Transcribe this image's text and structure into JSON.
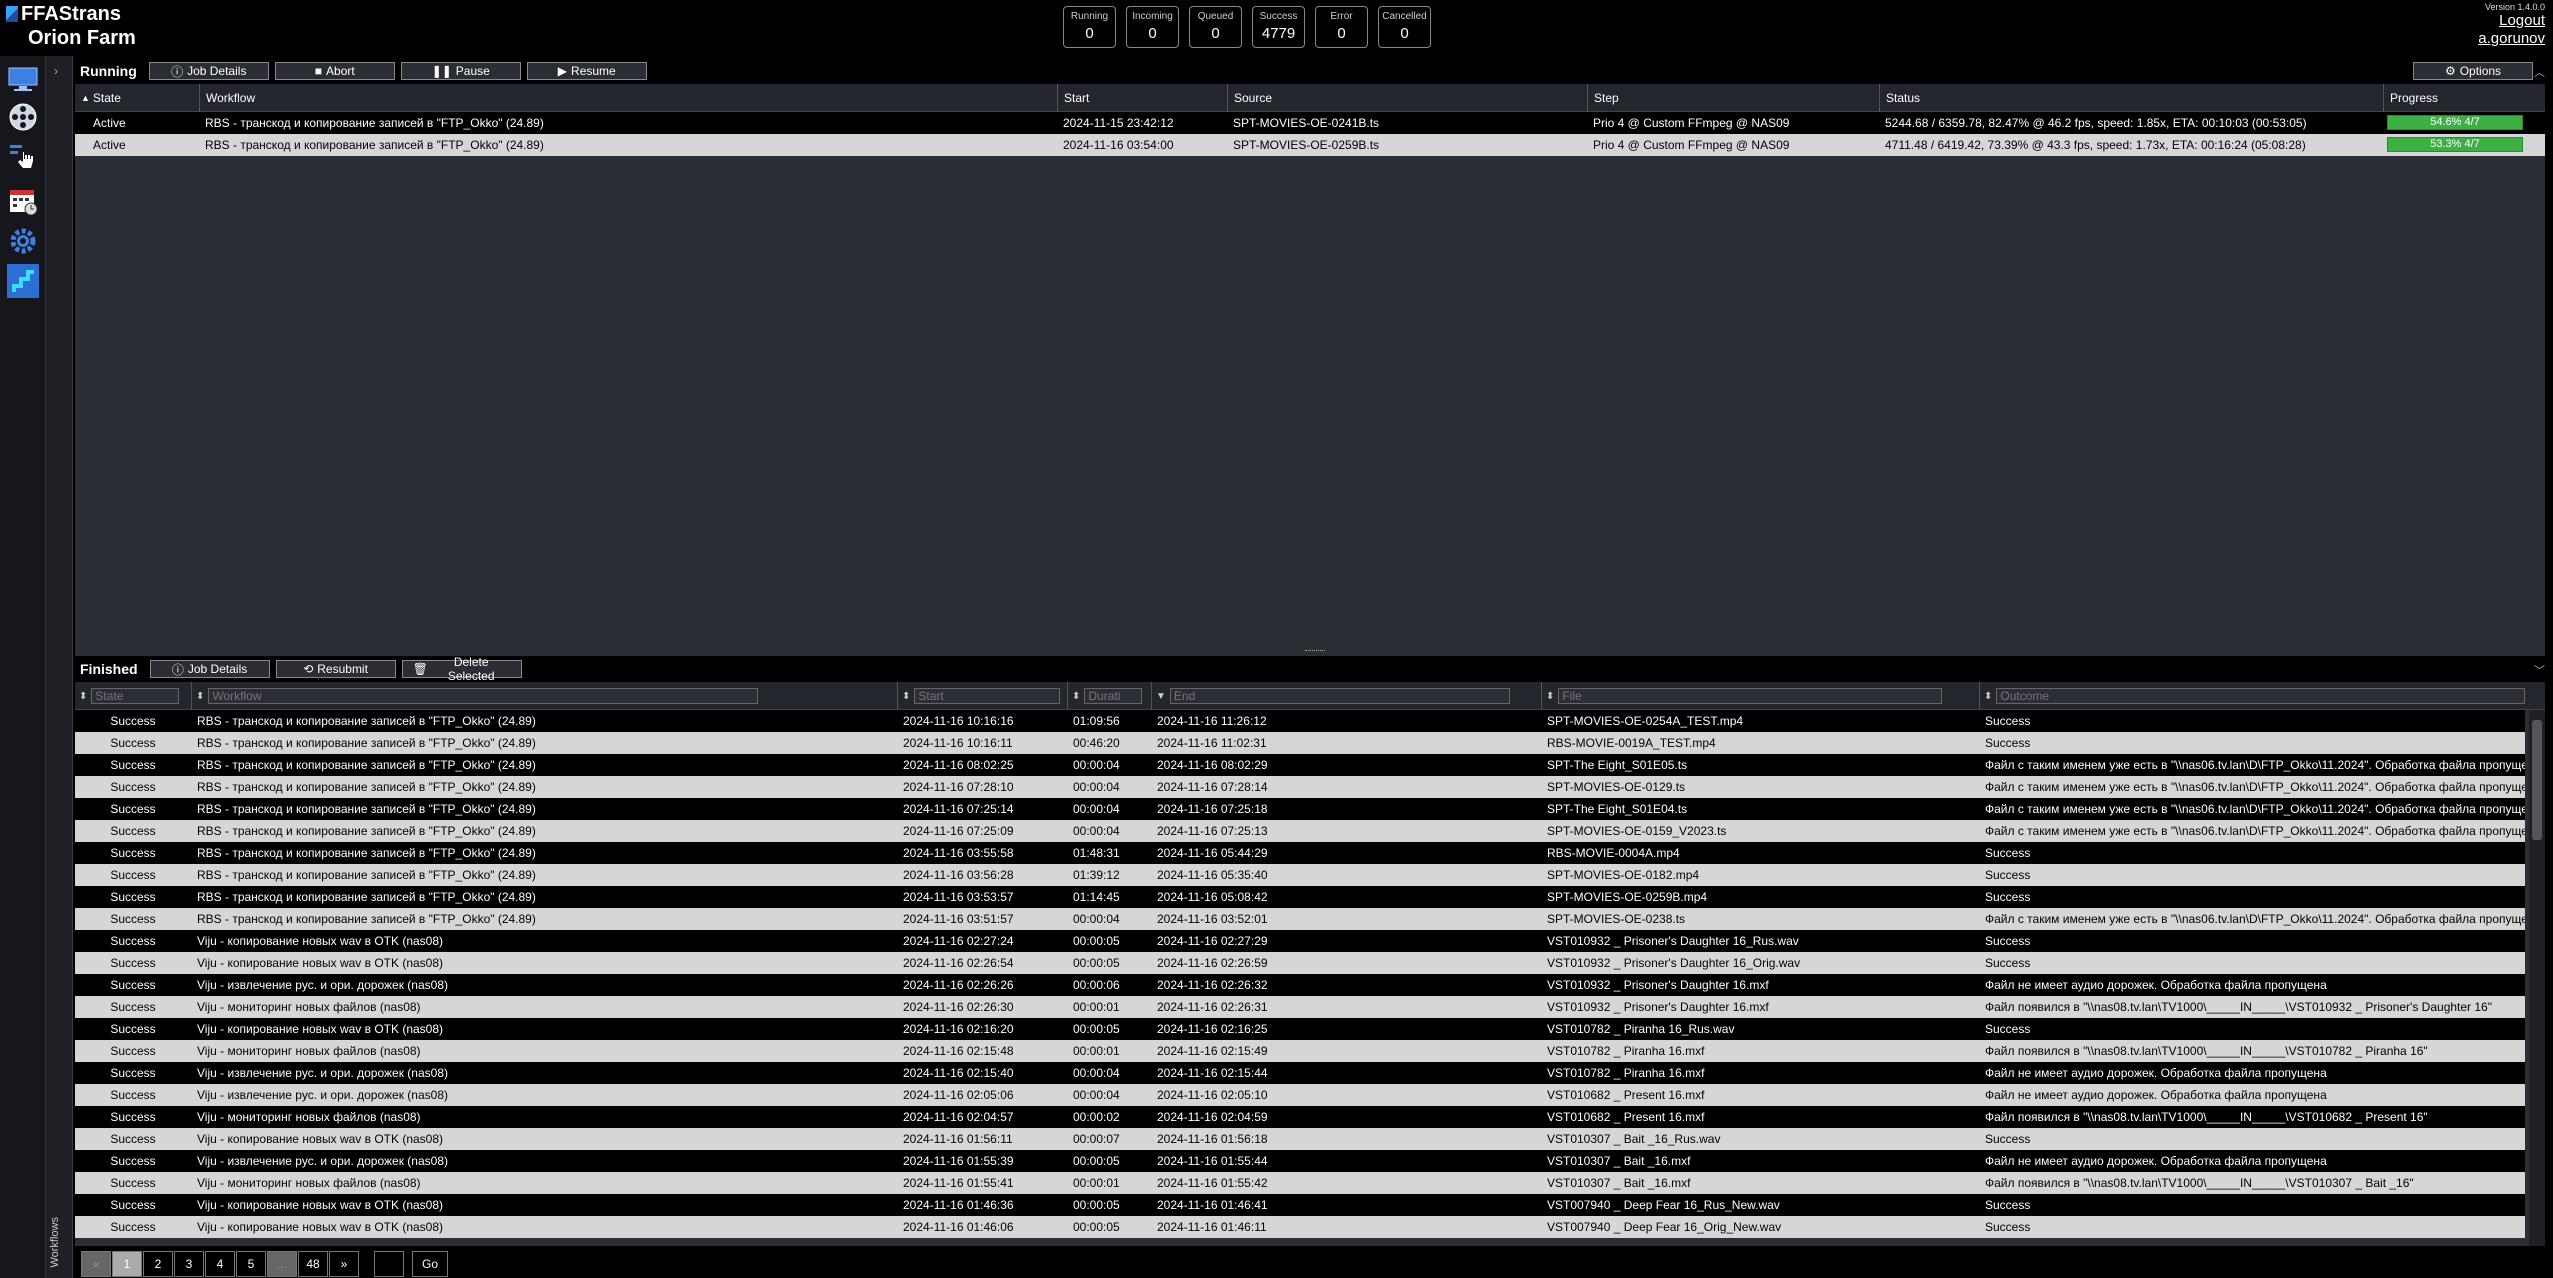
{
  "brand": {
    "line1": "FFAStrans",
    "line2": "Orion Farm"
  },
  "counters": [
    {
      "label": "Running",
      "value": "0"
    },
    {
      "label": "Incoming",
      "value": "0"
    },
    {
      "label": "Queued",
      "value": "0"
    },
    {
      "label": "Success",
      "value": "4779"
    },
    {
      "label": "Error",
      "value": "0"
    },
    {
      "label": "Cancelled",
      "value": "0"
    }
  ],
  "user": {
    "version": "Version 1.4.0.0",
    "logout": "Logout",
    "username": "a.gorunov"
  },
  "sidebar": {
    "workflows_label": "Workflows"
  },
  "running": {
    "title": "Running",
    "buttons": {
      "job_details": "Job Details",
      "abort": "Abort",
      "pause": "Pause",
      "resume": "Resume",
      "options": "Options"
    },
    "columns": [
      "State",
      "Workflow",
      "Start",
      "Source",
      "Step",
      "Status",
      "Progress"
    ],
    "rows": [
      {
        "state": "Active",
        "workflow": "RBS - транскод и копирование записей в \"FTP_Okko\" (24.89)",
        "start": "2024-11-15 23:42:12",
        "source": "SPT-MOVIES-OE-0241B.ts",
        "step": "Prio 4 @ Custom FFmpeg @ NAS09",
        "status": "5244.68 / 6359.78, 82.47% @ 46.2 fps, speed: 1.85x, ETA: 00:10:03 (00:53:05)",
        "progress": "54.6% 4/7",
        "progress_value": 0.546
      },
      {
        "state": "Active",
        "workflow": "RBS - транскод и копирование записей в \"FTP_Okko\" (24.89)",
        "start": "2024-11-16 03:54:00",
        "source": "SPT-MOVIES-OE-0259B.ts",
        "step": "Prio 4 @ Custom FFmpeg @ NAS09",
        "status": "4711.48 / 6419.42, 73.39% @ 43.3 fps, speed: 1.73x, ETA: 00:16:24 (05:08:28)",
        "progress": "53.3% 4/7",
        "progress_value": 0.533
      }
    ]
  },
  "finished": {
    "title": "Finished",
    "buttons": {
      "job_details": "Job Details",
      "resubmit": "Resubmit",
      "delete_selected": "Delete Selected"
    },
    "filters": {
      "state": "State",
      "workflow": "Workflow",
      "start": "Start",
      "duration": "Durati",
      "end": "End",
      "file": "File",
      "outcome": "Outcome"
    },
    "rows": [
      {
        "state": "Success",
        "workflow": "RBS - транскод и копирование записей в \"FTP_Okko\" (24.89)",
        "start": "2024-11-16 10:16:16",
        "duration": "01:09:56",
        "end": "2024-11-16 11:26:12",
        "file": "SPT-MOVIES-OE-0254A_TEST.mp4",
        "outcome": "Success"
      },
      {
        "state": "Success",
        "workflow": "RBS - транскод и копирование записей в \"FTP_Okko\" (24.89)",
        "start": "2024-11-16 10:16:11",
        "duration": "00:46:20",
        "end": "2024-11-16 11:02:31",
        "file": "RBS-MOVIE-0019A_TEST.mp4",
        "outcome": "Success"
      },
      {
        "state": "Success",
        "workflow": "RBS - транскод и копирование записей в \"FTP_Okko\" (24.89)",
        "start": "2024-11-16 08:02:25",
        "duration": "00:00:04",
        "end": "2024-11-16 08:02:29",
        "file": "SPT-The Eight_S01E05.ts",
        "outcome": "Файл с таким именем уже есть в \"\\\\nas06.tv.lan\\D\\FTP_Okko\\11.2024\". Обработка файла пропущена"
      },
      {
        "state": "Success",
        "workflow": "RBS - транскод и копирование записей в \"FTP_Okko\" (24.89)",
        "start": "2024-11-16 07:28:10",
        "duration": "00:00:04",
        "end": "2024-11-16 07:28:14",
        "file": "SPT-MOVIES-OE-0129.ts",
        "outcome": "Файл с таким именем уже есть в \"\\\\nas06.tv.lan\\D\\FTP_Okko\\11.2024\". Обработка файла пропущена"
      },
      {
        "state": "Success",
        "workflow": "RBS - транскод и копирование записей в \"FTP_Okko\" (24.89)",
        "start": "2024-11-16 07:25:14",
        "duration": "00:00:04",
        "end": "2024-11-16 07:25:18",
        "file": "SPT-The Eight_S01E04.ts",
        "outcome": "Файл с таким именем уже есть в \"\\\\nas06.tv.lan\\D\\FTP_Okko\\11.2024\". Обработка файла пропущена"
      },
      {
        "state": "Success",
        "workflow": "RBS - транскод и копирование записей в \"FTP_Okko\" (24.89)",
        "start": "2024-11-16 07:25:09",
        "duration": "00:00:04",
        "end": "2024-11-16 07:25:13",
        "file": "SPT-MOVIES-OE-0159_V2023.ts",
        "outcome": "Файл с таким именем уже есть в \"\\\\nas06.tv.lan\\D\\FTP_Okko\\11.2024\". Обработка файла пропущена"
      },
      {
        "state": "Success",
        "workflow": "RBS - транскод и копирование записей в \"FTP_Okko\" (24.89)",
        "start": "2024-11-16 03:55:58",
        "duration": "01:48:31",
        "end": "2024-11-16 05:44:29",
        "file": "RBS-MOVIE-0004A.mp4",
        "outcome": "Success"
      },
      {
        "state": "Success",
        "workflow": "RBS - транскод и копирование записей в \"FTP_Okko\" (24.89)",
        "start": "2024-11-16 03:56:28",
        "duration": "01:39:12",
        "end": "2024-11-16 05:35:40",
        "file": "SPT-MOVIES-OE-0182.mp4",
        "outcome": "Success"
      },
      {
        "state": "Success",
        "workflow": "RBS - транскод и копирование записей в \"FTP_Okko\" (24.89)",
        "start": "2024-11-16 03:53:57",
        "duration": "01:14:45",
        "end": "2024-11-16 05:08:42",
        "file": "SPT-MOVIES-OE-0259B.mp4",
        "outcome": "Success"
      },
      {
        "state": "Success",
        "workflow": "RBS - транскод и копирование записей в \"FTP_Okko\" (24.89)",
        "start": "2024-11-16 03:51:57",
        "duration": "00:00:04",
        "end": "2024-11-16 03:52:01",
        "file": "SPT-MOVIES-OE-0238.ts",
        "outcome": "Файл с таким именем уже есть в \"\\\\nas06.tv.lan\\D\\FTP_Okko\\11.2024\". Обработка файла пропущена"
      },
      {
        "state": "Success",
        "workflow": "Viju - копирование новых wav в OTK (nas08)",
        "start": "2024-11-16 02:27:24",
        "duration": "00:00:05",
        "end": "2024-11-16 02:27:29",
        "file": "VST010932 _ Prisoner's Daughter 16_Rus.wav",
        "outcome": "Success"
      },
      {
        "state": "Success",
        "workflow": "Viju - копирование новых wav в OTK (nas08)",
        "start": "2024-11-16 02:26:54",
        "duration": "00:00:05",
        "end": "2024-11-16 02:26:59",
        "file": "VST010932 _ Prisoner's Daughter 16_Orig.wav",
        "outcome": "Success"
      },
      {
        "state": "Success",
        "workflow": "Viju - извлечение рус. и ори. дорожек (nas08)",
        "start": "2024-11-16 02:26:26",
        "duration": "00:00:06",
        "end": "2024-11-16 02:26:32",
        "file": "VST010932 _ Prisoner's Daughter 16.mxf",
        "outcome": "Файл не имеет аудио дорожек. Обработка файла пропущена"
      },
      {
        "state": "Success",
        "workflow": "Viju - мониторинг новых файлов (nas08)",
        "start": "2024-11-16 02:26:30",
        "duration": "00:00:01",
        "end": "2024-11-16 02:26:31",
        "file": "VST010932 _ Prisoner's Daughter 16.mxf",
        "outcome": "Файл появился в \"\\\\nas08.tv.lan\\TV1000\\_____IN_____\\VST010932 _ Prisoner's Daughter 16\""
      },
      {
        "state": "Success",
        "workflow": "Viju - копирование новых wav в OTK (nas08)",
        "start": "2024-11-16 02:16:20",
        "duration": "00:00:05",
        "end": "2024-11-16 02:16:25",
        "file": "VST010782 _ Piranha 16_Rus.wav",
        "outcome": "Success"
      },
      {
        "state": "Success",
        "workflow": "Viju - мониторинг новых файлов (nas08)",
        "start": "2024-11-16 02:15:48",
        "duration": "00:00:01",
        "end": "2024-11-16 02:15:49",
        "file": "VST010782 _ Piranha 16.mxf",
        "outcome": "Файл появился в \"\\\\nas08.tv.lan\\TV1000\\_____IN_____\\VST010782 _ Piranha 16\""
      },
      {
        "state": "Success",
        "workflow": "Viju - извлечение рус. и ори. дорожек (nas08)",
        "start": "2024-11-16 02:15:40",
        "duration": "00:00:04",
        "end": "2024-11-16 02:15:44",
        "file": "VST010782 _ Piranha 16.mxf",
        "outcome": "Файл не имеет аудио дорожек. Обработка файла пропущена"
      },
      {
        "state": "Success",
        "workflow": "Viju - извлечение рус. и ори. дорожек (nas08)",
        "start": "2024-11-16 02:05:06",
        "duration": "00:00:04",
        "end": "2024-11-16 02:05:10",
        "file": "VST010682 _ Present 16.mxf",
        "outcome": "Файл не имеет аудио дорожек. Обработка файла пропущена"
      },
      {
        "state": "Success",
        "workflow": "Viju - мониторинг новых файлов (nas08)",
        "start": "2024-11-16 02:04:57",
        "duration": "00:00:02",
        "end": "2024-11-16 02:04:59",
        "file": "VST010682 _ Present 16.mxf",
        "outcome": "Файл появился в \"\\\\nas08.tv.lan\\TV1000\\_____IN_____\\VST010682 _ Present 16\""
      },
      {
        "state": "Success",
        "workflow": "Viju - копирование новых wav в OTK (nas08)",
        "start": "2024-11-16 01:56:11",
        "duration": "00:00:07",
        "end": "2024-11-16 01:56:18",
        "file": "VST010307 _ Bait _16_Rus.wav",
        "outcome": "Success"
      },
      {
        "state": "Success",
        "workflow": "Viju - извлечение рус. и ори. дорожек (nas08)",
        "start": "2024-11-16 01:55:39",
        "duration": "00:00:05",
        "end": "2024-11-16 01:55:44",
        "file": "VST010307 _ Bait _16.mxf",
        "outcome": "Файл не имеет аудио дорожек. Обработка файла пропущена"
      },
      {
        "state": "Success",
        "workflow": "Viju - мониторинг новых файлов (nas08)",
        "start": "2024-11-16 01:55:41",
        "duration": "00:00:01",
        "end": "2024-11-16 01:55:42",
        "file": "VST010307 _ Bait _16.mxf",
        "outcome": "Файл появился в \"\\\\nas08.tv.lan\\TV1000\\_____IN_____\\VST010307 _ Bait _16\""
      },
      {
        "state": "Success",
        "workflow": "Viju - копирование новых wav в OTK (nas08)",
        "start": "2024-11-16 01:46:36",
        "duration": "00:00:05",
        "end": "2024-11-16 01:46:41",
        "file": "VST007940 _ Deep Fear 16_Rus_New.wav",
        "outcome": "Success"
      },
      {
        "state": "Success",
        "workflow": "Viju - копирование новых wav в OTK (nas08)",
        "start": "2024-11-16 01:46:06",
        "duration": "00:00:05",
        "end": "2024-11-16 01:46:11",
        "file": "VST007940 _ Deep Fear 16_Orig_New.wav",
        "outcome": "Success"
      }
    ]
  },
  "pager": {
    "prev": "«",
    "pages": [
      "1",
      "2",
      "3",
      "4",
      "5",
      "...",
      "48"
    ],
    "next": "»",
    "go": "Go"
  }
}
